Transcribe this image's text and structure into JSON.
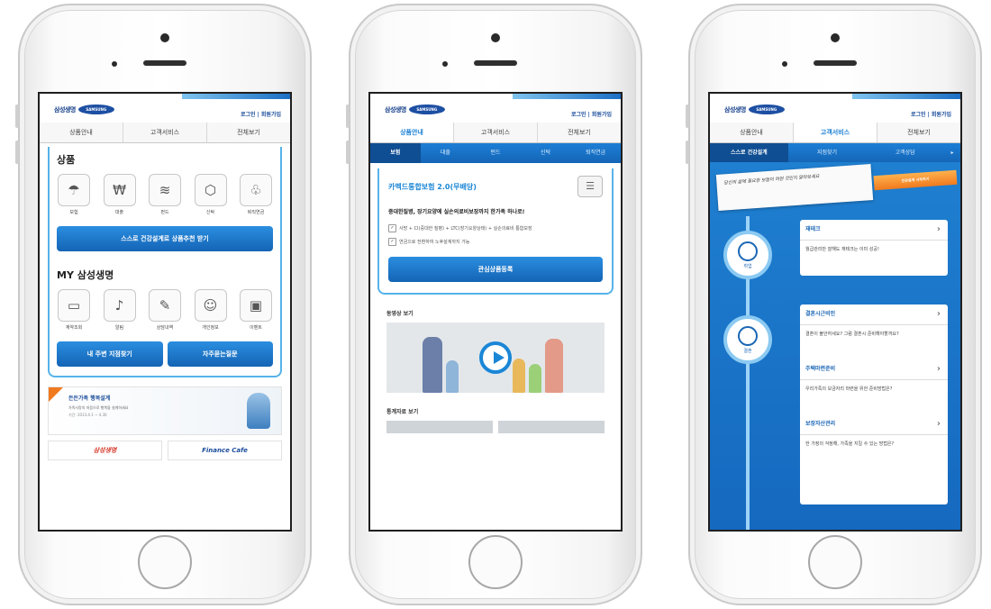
{
  "brand": {
    "kr": "삼성생명",
    "en": "SAMSUNG"
  },
  "header": {
    "login": "로그인 | 회원가입"
  },
  "gnb": [
    "상품안내",
    "고객서비스",
    "전체보기"
  ],
  "screen1": {
    "section_products": "상품",
    "products": [
      {
        "icon": "umbrella-icon",
        "label": "보험"
      },
      {
        "icon": "loan-icon",
        "label": "대출"
      },
      {
        "icon": "fund-icon",
        "label": "펀드"
      },
      {
        "icon": "trust-icon",
        "label": "신탁"
      },
      {
        "icon": "pension-icon",
        "label": "퇴직연금"
      }
    ],
    "cta": "스스로 건강설계로 상품추천 받기",
    "section_my": "MY 삼성생명",
    "my_items": [
      {
        "icon": "contract-icon",
        "label": "계약조회"
      },
      {
        "icon": "bell-icon",
        "label": "알림"
      },
      {
        "icon": "edit-icon",
        "label": "상담내역"
      },
      {
        "icon": "person-icon",
        "label": "개인정보"
      },
      {
        "icon": "gift-icon",
        "label": "이벤트"
      }
    ],
    "btn_left": "내 주변 지점찾기",
    "btn_right": "자주묻는질문",
    "banner_title": "든든가족 행복설계",
    "banner_line1": "가족사랑의 마음으로 행복을 설계하세요",
    "banner_line2": "기간: 2013.4.1 ~ 4.30",
    "footer_logos": [
      "삼성생명",
      "Finance Cafe"
    ]
  },
  "screen2": {
    "gnb_active": "상품안내",
    "subnav": [
      "보험",
      "대출",
      "펀드",
      "신탁",
      "퇴직연금"
    ],
    "card_title": "카멕드통합보험 2.0(무배당)",
    "card_desc": "중대한질병, 장기요양에 실손의료비보장까지 한가족 하나로!",
    "checks": [
      "사망 + CI(중대한 질병) + LTC(장기요양상태) + 실손의료비 통합보장",
      "연금으로 전환하여 노후설계까지 가능"
    ],
    "cta": "관심상품등록",
    "video_label": "동영상 보기",
    "table_label": "통계자료 보기"
  },
  "screen3": {
    "gnb_active": "고객서비스",
    "subnav": [
      "스스로 건강설계",
      "지점찾기",
      "고객상담",
      "▸"
    ],
    "note_text": "당신의 삶에 필요한 보험이 어떤 것인지 알아보세요",
    "pencil_label": "건강설계 시작하기",
    "stage1_label": "취업",
    "stage2_label": "결혼",
    "boxes": [
      {
        "title": "재테크",
        "body": "월급관리만 잘해도 재테크는 이미 성공!"
      },
      {
        "title": "결혼시근비인",
        "body": "결혼이 불안하세요? 그럼 결혼시 준비해야할까요?"
      },
      {
        "title": "주택마련준비",
        "body": "우리가족의 보금자리 마련을 위한 준비방법은?"
      },
      {
        "title": "보장자산관리",
        "body": "한 가정의 걱정해, 가족을 지킬 수 있는 방법은?"
      }
    ]
  }
}
